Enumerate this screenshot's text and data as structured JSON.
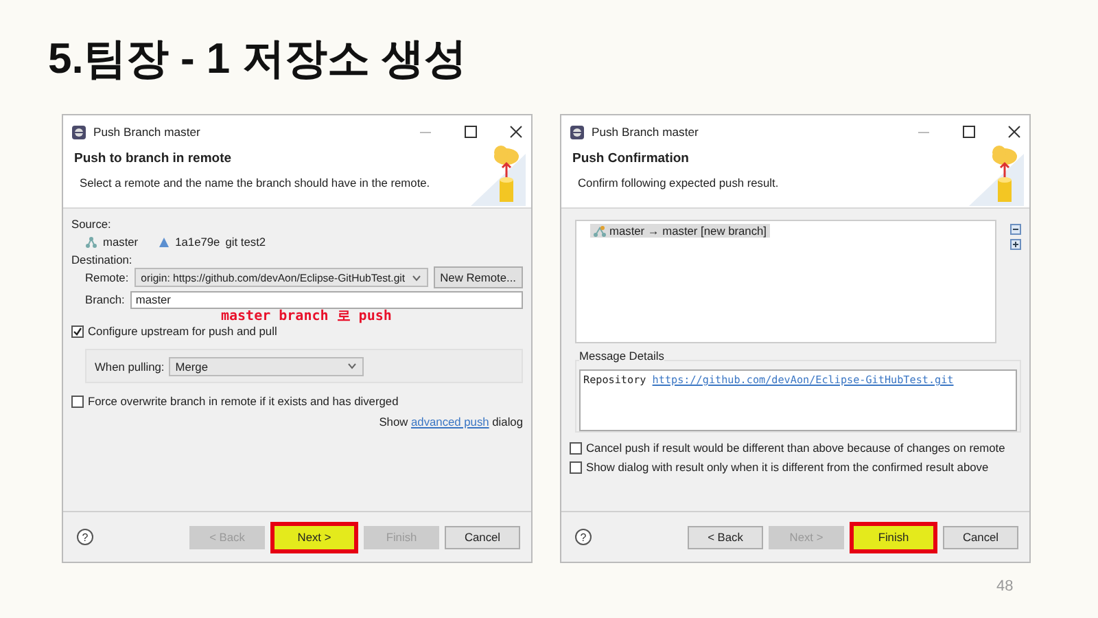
{
  "slide": {
    "title": "5.팀장 - 1 저장소 생성",
    "page_number": "48"
  },
  "dialogs": [
    {
      "kind": "push_branch",
      "help": "?",
      "window_title": "Push Branch master",
      "heading": "Push to branch in remote",
      "description": "Select a remote and the name the branch should have in the remote.",
      "source_label": "Source:",
      "source_branch": "master",
      "source_commit": "1a1e79e",
      "source_message": "git test2",
      "destination_label": "Destination:",
      "remote_label": "Remote:",
      "remote_value": "origin: https://github.com/devAon/Eclipse-GitHubTest.git",
      "new_remote_button": "New Remote...",
      "branch_label": "Branch:",
      "branch_value": "master",
      "annotation": "master branch 로 push",
      "checkboxes": [
        {
          "label": "Configure upstream for push and pull",
          "checked": true
        }
      ],
      "pulling_label": "When pulling:",
      "pulling_value": "Merge",
      "extra_checkboxes": [
        {
          "label": "Force overwrite branch in remote if it exists and has diverged",
          "checked": false
        }
      ],
      "advanced_before": "Show",
      "advanced_link": "advanced push",
      "advanced_after": "dialog",
      "buttons": [
        {
          "label": "< Back",
          "disabled": true,
          "highlighted": false
        },
        {
          "label": "Next >",
          "disabled": false,
          "highlighted": true
        },
        {
          "label": "Finish",
          "disabled": true,
          "highlighted": false
        },
        {
          "label": "Cancel",
          "disabled": false,
          "highlighted": false
        }
      ]
    },
    {
      "kind": "push_confirmation",
      "help": "?",
      "window_title": "Push Branch master",
      "heading": "Push Confirmation",
      "description": "Confirm following expected push result.",
      "results": [
        {
          "label": "master → master [new branch]",
          "selected": true
        }
      ],
      "message_label": "Message Details",
      "message_prefix": "Repository",
      "message_link": "https://github.com/devAon/Eclipse-GitHubTest.git",
      "checkboxes": [
        {
          "label": "Cancel push if result would be different than above because of changes on remote",
          "checked": false
        },
        {
          "label": "Show dialog with result only when it is different from the confirmed result above",
          "checked": false
        }
      ],
      "buttons": [
        {
          "label": "< Back",
          "disabled": false,
          "highlighted": false
        },
        {
          "label": "Next >",
          "disabled": true,
          "highlighted": false
        },
        {
          "label": "Finish",
          "disabled": false,
          "highlighted": true
        },
        {
          "label": "Cancel",
          "disabled": false,
          "highlighted": false
        }
      ]
    }
  ]
}
